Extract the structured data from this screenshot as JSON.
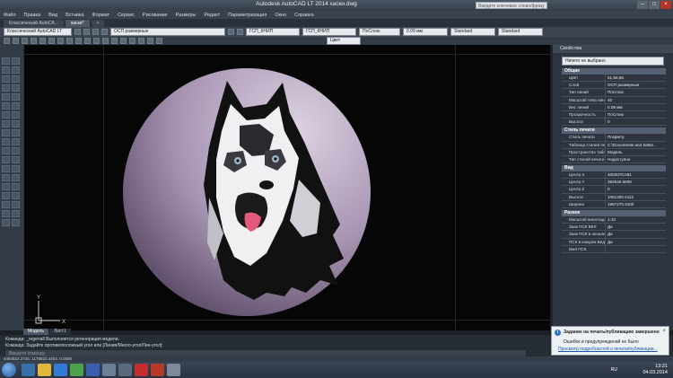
{
  "window": {
    "title": "Autodesk AutoCAD LT 2014   хаски.dwg",
    "search_placeholder": "Введите ключевое слово/фразу",
    "controls": [
      "–",
      "□",
      "×"
    ]
  },
  "menu": {
    "items": [
      "Файл",
      "Правка",
      "Вид",
      "Вставка",
      "Формат",
      "Сервис",
      "Рисование",
      "Размеры",
      "Редакт",
      "Параметризация",
      "Окно",
      "Справка"
    ]
  },
  "tabs": [
    {
      "label": "Классический AutoCA...",
      "active": false
    },
    {
      "label": "хаски*",
      "active": true
    },
    {
      "label": "+",
      "active": false
    }
  ],
  "toolbar": {
    "workspace": "Классический AutoCAD LT",
    "layer": "ОСП размерные",
    "layer_state": "ГСП_КНИП",
    "bylayer": "ПоСлою",
    "lineweight": "0.09 мм",
    "style": "Standard",
    "style2": "Standard",
    "color_label": "Цвет"
  },
  "layout_tabs": [
    {
      "label": "Модель",
      "active": true
    },
    {
      "label": "Лист1",
      "active": false
    }
  ],
  "properties": {
    "title": "Свойства",
    "selection": "Ничего не выбрано",
    "sections": [
      {
        "name": "Общие",
        "rows": [
          {
            "k": "Цвет",
            "v": "51,56,56"
          },
          {
            "k": "Слой",
            "v": "ОСП размерные"
          },
          {
            "k": "Тип линий",
            "v": "ПоСлою"
          },
          {
            "k": "Масштаб типа линий",
            "v": "40"
          },
          {
            "k": "Вес линий",
            "v": "0.09 мм"
          },
          {
            "k": "Прозрачность",
            "v": "ПоСлою"
          },
          {
            "k": "Высота",
            "v": "0"
          }
        ]
      },
      {
        "name": "Стиль печати",
        "rows": [
          {
            "k": "Стиль печати",
            "v": "ПоЦвету"
          },
          {
            "k": "Таблица стилей печати",
            "v": "C:\\Documents and Settin..."
          },
          {
            "k": "Пространство табли...",
            "v": "Модель"
          },
          {
            "k": "Тип стилей печати",
            "v": "Недоступно"
          }
        ]
      },
      {
        "name": "Вид",
        "rows": [
          {
            "k": "Центр X",
            "v": "4003070.081"
          },
          {
            "k": "Центр Y",
            "v": "392545.5600"
          },
          {
            "k": "Центр Z",
            "v": "0"
          },
          {
            "k": "Высота",
            "v": "1051300.4112"
          },
          {
            "k": "Ширина",
            "v": "1957270.3100"
          }
        ]
      },
      {
        "name": "Разное",
        "rows": [
          {
            "k": "Масштаб аннотаций",
            "v": "1:10"
          },
          {
            "k": "Знак ПСК ВКЛ",
            "v": "Да"
          },
          {
            "k": "Знак ПСК в начале коорд.",
            "v": "Да"
          },
          {
            "k": "ПСК в каждом Видовом",
            "v": "Да"
          },
          {
            "k": "Имя ПСК",
            "v": ""
          }
        ]
      }
    ]
  },
  "command": {
    "line1": "Команда: _regenall Выполняется регенерация модели.",
    "line2": "Команда: Задайте противоположный угол или [Линия/Много-угол/Лин-угол]:",
    "input_placeholder": "Введите команду"
  },
  "statusbar": {
    "coords": "4464922.2734, 1178823.4403, 0.0000"
  },
  "notification": {
    "title": "Задание на печать/публикацию завершено",
    "message": "Ошибок и предупреждений не было",
    "link": "Просмотр подробностей о печати/публикации...",
    "close": "×"
  },
  "taskbar": {
    "lang": "RU",
    "time": "13:21",
    "date": "04.03.2014"
  },
  "colors": {
    "canvas": "#060606",
    "circle_light": "#d6c9dc",
    "circle_dark": "#5a4a66",
    "panel": "#2e3540",
    "accent": "#2f6fc4"
  },
  "icons": {
    "start": "windows-start-icon",
    "ucs": "ucs-axis-icon",
    "notif": "info-icon"
  }
}
